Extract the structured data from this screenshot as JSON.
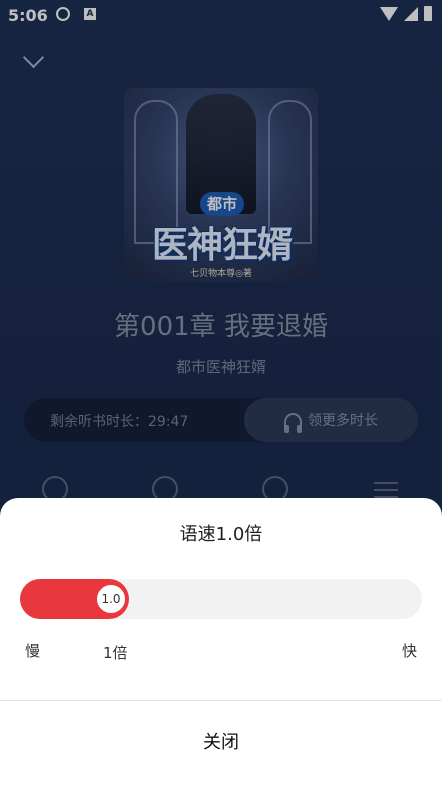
{
  "status_bar": {
    "time": "5:06",
    "app_badge": "A"
  },
  "book": {
    "cover": {
      "series_badge": "都市",
      "title_art": "医神狂婿",
      "author_line": "七贝物本尊◎著"
    },
    "chapter_title": "第001章 我要退婚",
    "book_name": "都市医神狂婿"
  },
  "listen_time": {
    "remaining_label": "剩余听书时长：29:47",
    "more_time_label": "领更多时长"
  },
  "speed_sheet": {
    "title": "语速1.0倍",
    "slider_value": "1.0",
    "slider_fraction": 0.27,
    "slow_label": "慢",
    "fast_label": "快",
    "current_label": "1倍",
    "close_label": "关闭",
    "accent_color": "#e8383d"
  },
  "icons": [
    "chevron-down-icon",
    "headphone-icon",
    "alarm-icon",
    "add-icon",
    "speed-icon",
    "playlist-icon"
  ]
}
